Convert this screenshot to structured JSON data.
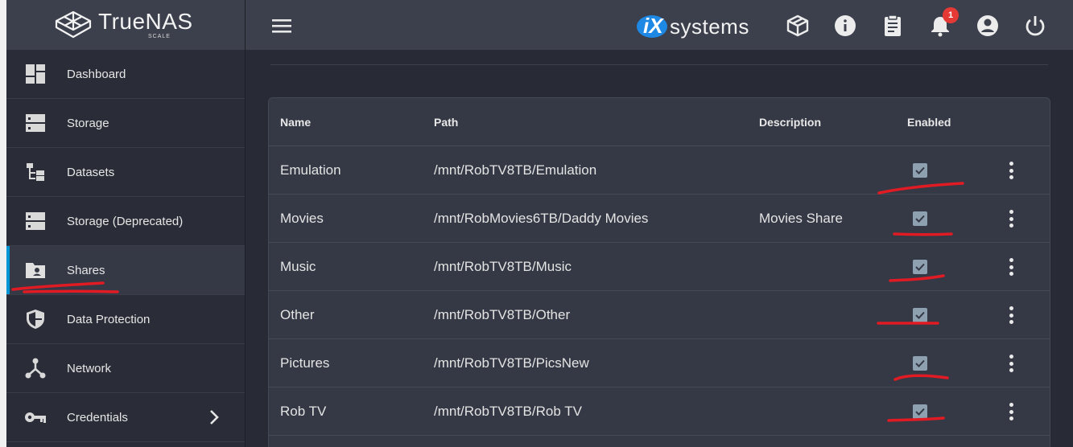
{
  "brand": {
    "name": "TrueNAS",
    "edition": "SCALE"
  },
  "topbar": {
    "vendor_logo_text": "systems",
    "vendor_logo_mark": "iX",
    "notification_count": "1",
    "icons": [
      "menu-icon",
      "truecommand-icon",
      "info-icon",
      "clipboard-icon",
      "bell-icon",
      "account-icon",
      "power-icon"
    ]
  },
  "sidebar": {
    "items": [
      {
        "label": "Dashboard",
        "icon": "dashboard-icon"
      },
      {
        "label": "Storage",
        "icon": "storage-icon"
      },
      {
        "label": "Datasets",
        "icon": "datasets-icon"
      },
      {
        "label": "Storage (Deprecated)",
        "icon": "storage-deprecated-icon"
      },
      {
        "label": "Shares",
        "icon": "folder-shared-icon",
        "active": true
      },
      {
        "label": "Data Protection",
        "icon": "shield-icon"
      },
      {
        "label": "Network",
        "icon": "network-icon"
      },
      {
        "label": "Credentials",
        "icon": "key-icon",
        "has_submenu": true
      }
    ]
  },
  "table": {
    "headers": {
      "name": "Name",
      "path": "Path",
      "description": "Description",
      "enabled": "Enabled"
    },
    "rows": [
      {
        "name": "Emulation",
        "path": "/mnt/RobTV8TB/Emulation",
        "description": "",
        "enabled": true
      },
      {
        "name": "Movies",
        "path": "/mnt/RobMovies6TB/Daddy Movies",
        "description": "Movies Share",
        "enabled": true
      },
      {
        "name": "Music",
        "path": "/mnt/RobTV8TB/Music",
        "description": "",
        "enabled": true
      },
      {
        "name": "Other",
        "path": "/mnt/RobTV8TB/Other",
        "description": "",
        "enabled": true
      },
      {
        "name": "Pictures",
        "path": "/mnt/RobTV8TB/PicsNew",
        "description": "",
        "enabled": true
      },
      {
        "name": "Rob TV",
        "path": "/mnt/RobTV8TB/Rob TV",
        "description": "",
        "enabled": true
      }
    ]
  },
  "colors": {
    "annotation": "#e01b24",
    "accent": "#0095d5",
    "checkbox": "#8ea1b0"
  }
}
